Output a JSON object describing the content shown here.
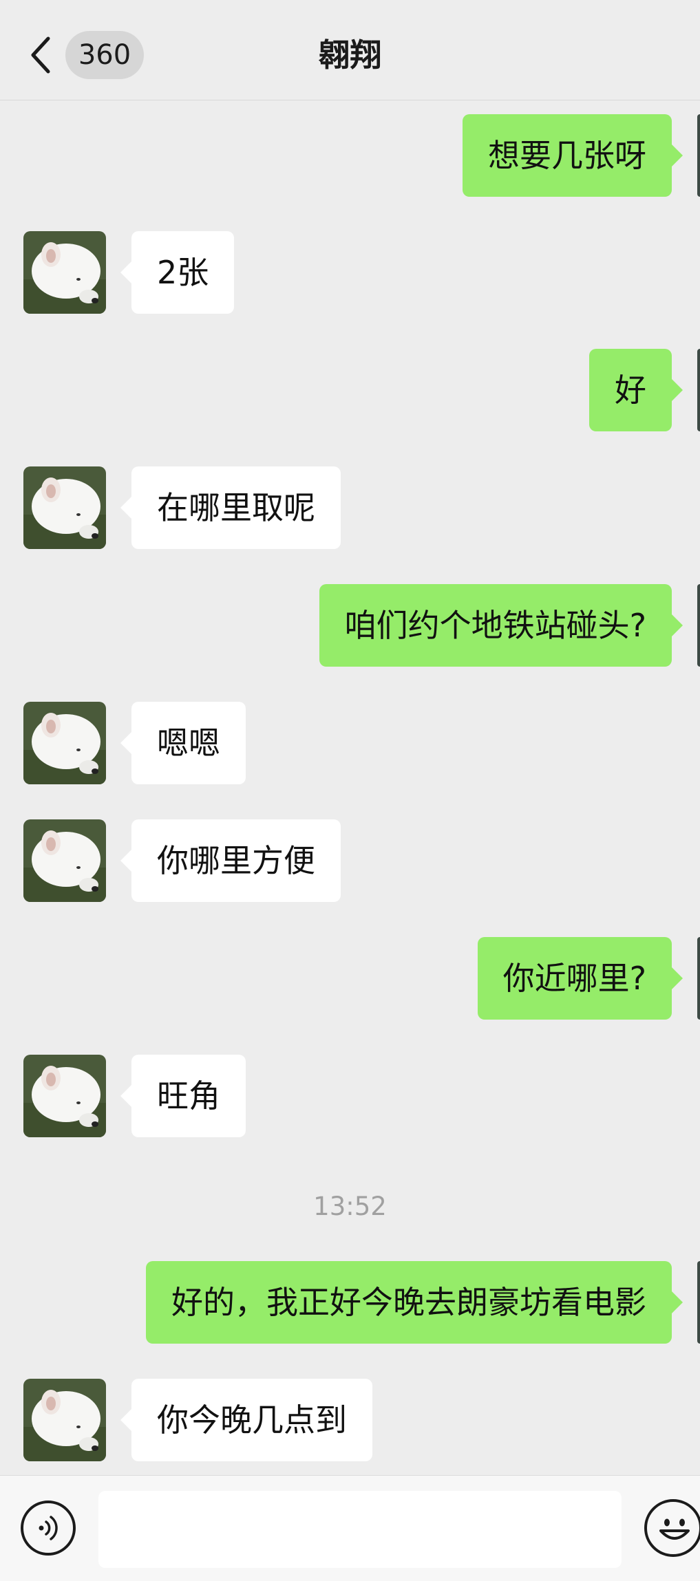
{
  "header": {
    "title": "翱翔",
    "unread_count": "360",
    "back_icon": "chevron-left-icon"
  },
  "messages": [
    {
      "side": "out",
      "text": "想要几张呀"
    },
    {
      "side": "in",
      "text": "2张"
    },
    {
      "side": "out",
      "text": "好"
    },
    {
      "side": "in",
      "text": "在哪里取呢"
    },
    {
      "side": "out",
      "text": "咱们约个地铁站碰头?"
    },
    {
      "side": "in",
      "text": "嗯嗯"
    },
    {
      "side": "in",
      "text": "你哪里方便"
    },
    {
      "side": "out",
      "text": "你近哪里?"
    },
    {
      "side": "in",
      "text": "旺角"
    },
    {
      "side": "out",
      "text": "好的，我正好今晚去朗豪坊看电影"
    },
    {
      "side": "in",
      "text": "你今晚几点到"
    }
  ],
  "timestamp": "13:52",
  "input": {
    "value": "",
    "voice_icon": "voice-icon",
    "emoji_icon": "emoji-icon"
  },
  "colors": {
    "background": "#ededed",
    "outgoing_bubble": "#95ec69",
    "incoming_bubble": "#ffffff",
    "timestamp_text": "#a0a0a0"
  }
}
